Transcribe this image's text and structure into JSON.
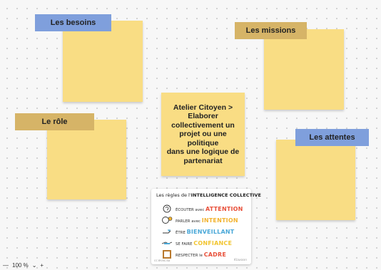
{
  "board": {
    "labels": {
      "besoins": "Les besoins",
      "missions": "Les missions",
      "role": "Le rôle",
      "attentes": "Les attentes"
    },
    "center_note": "Atelier Citoyen >\nElaborer\ncollectivement un\nprojet ou une politique\ndans une logique de\npartenariat"
  },
  "poster": {
    "title_prefix": "Les règles de l'",
    "title_main": "INTELLIGENCE COLLECTIVE",
    "rules": [
      {
        "prefix": "ÉCOUTER avec",
        "keyword": "ATTENTION",
        "color": "#e8503a",
        "icon": "ear-icon"
      },
      {
        "prefix": "PARLER avec",
        "keyword": "INTENTION",
        "color": "#f2b330",
        "icon": "speech-icon"
      },
      {
        "prefix": "ÊTRE",
        "keyword": "BIENVEILLANT",
        "color": "#4aa8d8",
        "icon": "heart-hand-icon"
      },
      {
        "prefix": "SE FAIRE",
        "keyword": "CONFIANCE",
        "color": "#f2c530",
        "icon": "handshake-icon"
      },
      {
        "prefix": "RESPECTER le",
        "keyword": "CADRE",
        "color": "#e8503a",
        "icon": "frame-icon"
      }
    ],
    "footer": "CC BY-NC-SA",
    "signature": "Klaxoon"
  },
  "zoom": {
    "minus": "—",
    "value": "100 %",
    "chevron": "⌄",
    "plus": "+"
  },
  "colors": {
    "note": "#f9dd84",
    "label_blue": "#7f9fdc",
    "label_gold": "#d6b467"
  }
}
